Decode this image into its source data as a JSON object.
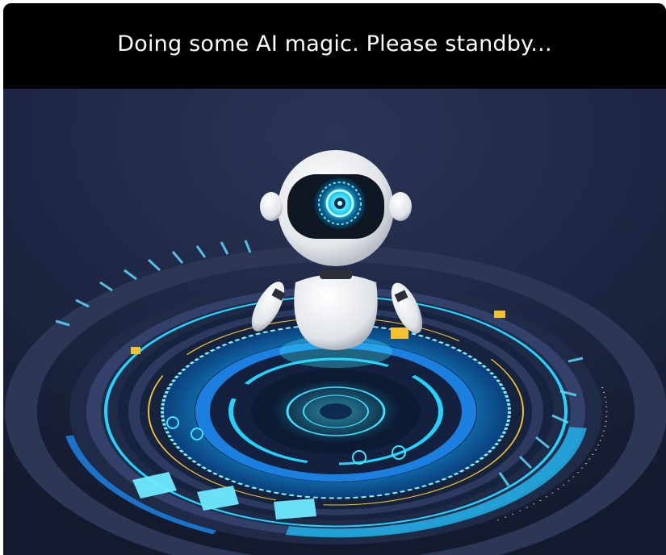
{
  "loading_modal": {
    "message": "Doing some AI magic. Please standby...",
    "illustration_icon": "robot-hologram-icon"
  },
  "colors": {
    "header_background": "#000000",
    "header_text": "#ffffff",
    "scene_background": "#1b2238",
    "accent_cyan": "#1fd0ff",
    "accent_blue": "#1b7fe0",
    "accent_yellow": "#f2c230"
  }
}
